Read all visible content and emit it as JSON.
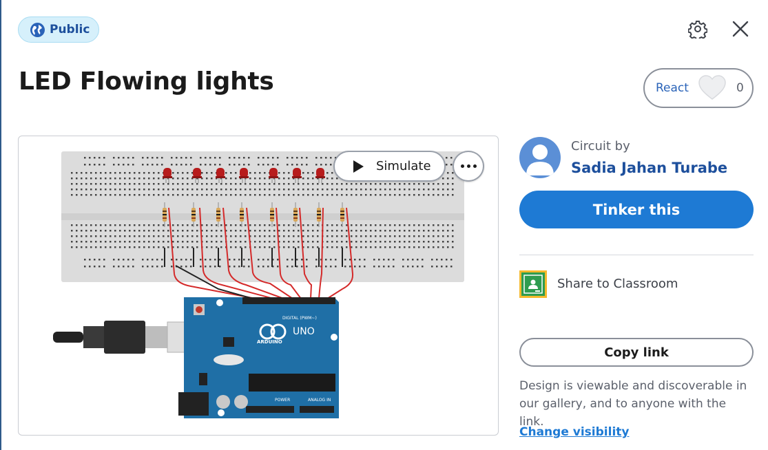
{
  "visibility_badge": {
    "label": "Public",
    "icon": "globe-icon"
  },
  "header": {
    "settings_icon": "gear-icon",
    "close_icon": "close-icon"
  },
  "design": {
    "title": "LED Flowing lights"
  },
  "react": {
    "label": "React",
    "count": "0",
    "icon": "heart-icon"
  },
  "preview": {
    "simulate_label": "Simulate",
    "more_icon": "more-options-icon",
    "board_label": "UNO",
    "board_brand": "ARDUINO",
    "header_labels": {
      "digital": "DIGITAL (PWM~)",
      "power": "POWER",
      "analog": "ANALOG IN"
    }
  },
  "author": {
    "prefix": "Circuit by",
    "name": "Sadia Jahan Turabe"
  },
  "actions": {
    "tinker_label": "Tinker this",
    "share_label": "Share to Classroom",
    "copy_label": "Copy link"
  },
  "visibility_info": {
    "description": "Design is viewable and discoverable in our gallery, and to anyone with the link.",
    "change_link": "Change visibility"
  },
  "colors": {
    "brand_blue": "#1e7ad4",
    "link_blue": "#1d4f9c",
    "badge_bg": "#d6f0fb",
    "wire_red": "#d42a2a"
  }
}
